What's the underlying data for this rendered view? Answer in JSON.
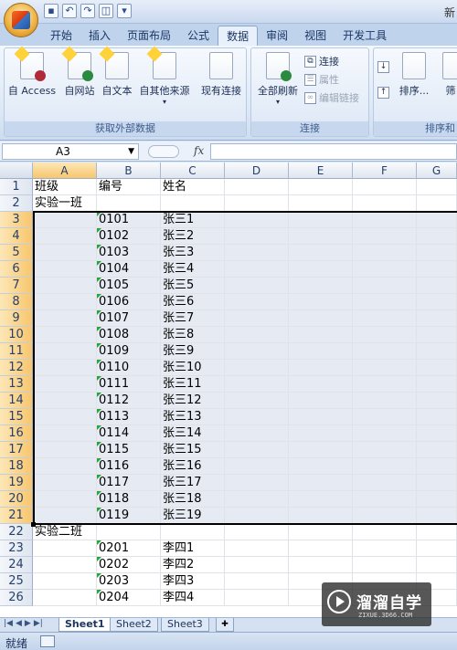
{
  "window": {
    "title_fragment": "新"
  },
  "tabs": [
    "开始",
    "插入",
    "页面布局",
    "公式",
    "数据",
    "审阅",
    "视图",
    "开发工具"
  ],
  "active_tab": "数据",
  "ribbon": {
    "get_external": {
      "label": "获取外部数据",
      "buttons": [
        "自 Access",
        "自网站",
        "自文本",
        "自其他来源",
        "现有连接"
      ]
    },
    "connections": {
      "label": "连接",
      "refresh": "全部刷新",
      "connect": "连接",
      "properties": "属性",
      "edit_links": "编辑链接"
    },
    "sort": {
      "label": "排序和",
      "sort_btn": "排序...",
      "filter_fragment": "筛"
    }
  },
  "formula_bar": {
    "name_box": "A3",
    "fx": "fx",
    "value": ""
  },
  "columns": [
    "A",
    "B",
    "C",
    "D",
    "E",
    "F",
    "G"
  ],
  "rows": [
    {
      "n": "1",
      "a": "班级",
      "b": "编号",
      "c": "姓名"
    },
    {
      "n": "2",
      "a": "实验一班",
      "b": "",
      "c": ""
    },
    {
      "n": "3",
      "a": "",
      "b": "0101",
      "c": "张三1"
    },
    {
      "n": "4",
      "a": "",
      "b": "0102",
      "c": "张三2"
    },
    {
      "n": "5",
      "a": "",
      "b": "0103",
      "c": "张三3"
    },
    {
      "n": "6",
      "a": "",
      "b": "0104",
      "c": "张三4"
    },
    {
      "n": "7",
      "a": "",
      "b": "0105",
      "c": "张三5"
    },
    {
      "n": "8",
      "a": "",
      "b": "0106",
      "c": "张三6"
    },
    {
      "n": "9",
      "a": "",
      "b": "0107",
      "c": "张三7"
    },
    {
      "n": "10",
      "a": "",
      "b": "0108",
      "c": "张三8"
    },
    {
      "n": "11",
      "a": "",
      "b": "0109",
      "c": "张三9"
    },
    {
      "n": "12",
      "a": "",
      "b": "0110",
      "c": "张三10"
    },
    {
      "n": "13",
      "a": "",
      "b": "0111",
      "c": "张三11"
    },
    {
      "n": "14",
      "a": "",
      "b": "0112",
      "c": "张三12"
    },
    {
      "n": "15",
      "a": "",
      "b": "0113",
      "c": "张三13"
    },
    {
      "n": "16",
      "a": "",
      "b": "0114",
      "c": "张三14"
    },
    {
      "n": "17",
      "a": "",
      "b": "0115",
      "c": "张三15"
    },
    {
      "n": "18",
      "a": "",
      "b": "0116",
      "c": "张三16"
    },
    {
      "n": "19",
      "a": "",
      "b": "0117",
      "c": "张三17"
    },
    {
      "n": "20",
      "a": "",
      "b": "0118",
      "c": "张三18"
    },
    {
      "n": "21",
      "a": "",
      "b": "0119",
      "c": "张三19"
    },
    {
      "n": "22",
      "a": "实验二班",
      "b": "",
      "c": ""
    },
    {
      "n": "23",
      "a": "",
      "b": "0201",
      "c": "李四1"
    },
    {
      "n": "24",
      "a": "",
      "b": "0202",
      "c": "李四2"
    },
    {
      "n": "25",
      "a": "",
      "b": "0203",
      "c": "李四3"
    },
    {
      "n": "26",
      "a": "",
      "b": "0204",
      "c": "李四4"
    }
  ],
  "selection": {
    "from_row": "3",
    "to_row": "21"
  },
  "sheets": [
    "Sheet1",
    "Sheet2",
    "Sheet3"
  ],
  "active_sheet": "Sheet1",
  "status": "就绪",
  "watermark": {
    "title": "溜溜自学",
    "sub": "ZIXUE.3D66.COM"
  }
}
